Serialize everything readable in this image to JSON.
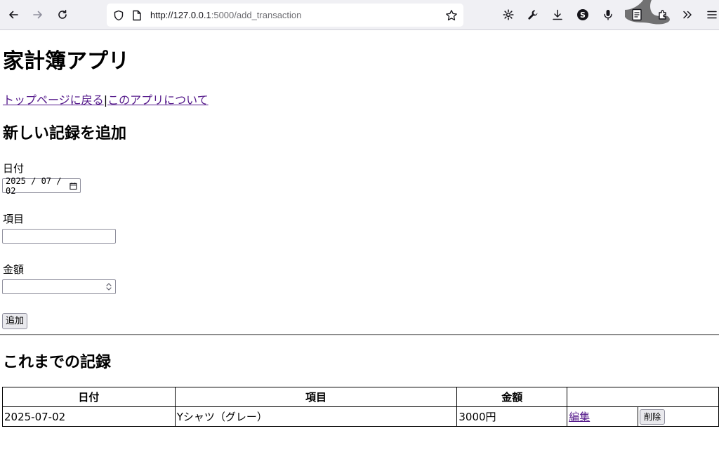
{
  "browser": {
    "url_host": "http://127.0.0.1",
    "url_rest": ":5000/add_transaction"
  },
  "app": {
    "title": "家計簿アプリ",
    "nav": {
      "home_link": "トップページに戻る",
      "separator": "|",
      "about_link": "このアプリについて"
    }
  },
  "form": {
    "heading": "新しい記録を追加",
    "date_label": "日付",
    "date_value": "2025 / 07 / 02",
    "item_label": "項目",
    "item_value": "",
    "amount_label": "金額",
    "amount_value": "",
    "submit_label": "追加"
  },
  "records": {
    "heading": "これまでの記録",
    "columns": [
      "日付",
      "項目",
      "金額",
      ""
    ],
    "rows": [
      {
        "date": "2025-07-02",
        "item": "Yシャツ（グレー）",
        "amount": "3000円",
        "edit_label": "編集",
        "delete_label": "削除"
      }
    ]
  },
  "colors": {
    "link_visited": "#551a8b",
    "toolbar_bg": "#f0f0f4"
  }
}
